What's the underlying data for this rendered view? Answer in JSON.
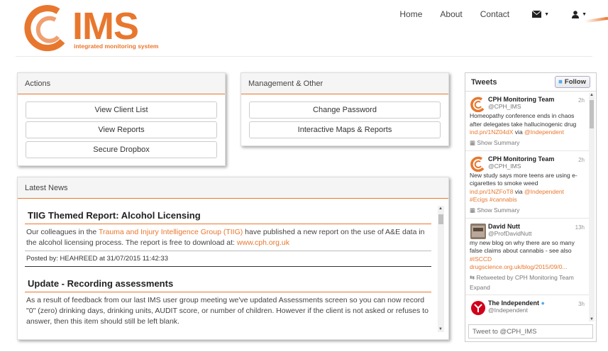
{
  "header": {
    "logo_text": "IMS",
    "logo_sub": "integrated monitoring system",
    "nav": {
      "home": "Home",
      "about": "About",
      "contact": "Contact"
    }
  },
  "actions": {
    "title": "Actions",
    "buttons": [
      "View Client List",
      "View Reports",
      "Secure Dropbox"
    ]
  },
  "management": {
    "title": "Management & Other",
    "buttons": [
      "Change Password",
      "Interactive Maps & Reports"
    ]
  },
  "news": {
    "title": "Latest News",
    "items": [
      {
        "heading": "TIIG Themed Report: Alcohol Licensing",
        "text_before": "Our colleagues in the ",
        "link1": "Trauma and Injury Intelligence Group (TIIG)",
        "text_mid": " have published a new report on the use of A&E data in the alcohol licensing process. The report is free to download at: ",
        "link2": "www.cph.org.uk",
        "posted": "Posted by: HEAHREED at 31/07/2015 11:42:33"
      },
      {
        "heading": "Update - Recording assessments",
        "text": "As a result of feedback from our last IMS user group meeting we've updated Assessments screen so you can now record \"0\" (zero) drinking days, drinking units, AUDIT score, or number of children. However if the client is not asked or refuses to answer, then this item should still be left blank."
      }
    ]
  },
  "tweets": {
    "title": "Tweets",
    "follow": "Follow",
    "input_placeholder": "Tweet to @CPH_IMS",
    "items": [
      {
        "name": "CPH Monitoring Team",
        "handle": "@CPH_IMS",
        "time": "2h",
        "text": "Homeopathy conference ends in chaos after delegates take hallucinogenic drug",
        "link": "ind.pn/1NZ04dX",
        "via": " via ",
        "mention": "@Independent",
        "footer": "Show Summary"
      },
      {
        "name": "CPH Monitoring Team",
        "handle": "@CPH_IMS",
        "time": "2h",
        "text": "New study says more teens are using e-cigarettes to smoke weed",
        "link": "ind.pn/1NZFoT8",
        "via": " via ",
        "mention": "@Independent",
        "tags": "#Ecigs #cannabis",
        "footer": "Show Summary"
      },
      {
        "name": "David Nutt",
        "handle": "@ProfDavidNutt",
        "time": "13h",
        "text": "my new blog on why there are so many false claims about cannabis - see also",
        "tags": "#ISCCD",
        "link": "drugscience.org.uk/blog/2015/09/0...",
        "retweet": "Retweeted by CPH Monitoring Team",
        "footer": "Expand"
      },
      {
        "name": "The Independent",
        "handle": "@Independent",
        "time": "3h"
      }
    ]
  },
  "colors": {
    "accent": "#e8772e",
    "twitter": "#55acee"
  }
}
